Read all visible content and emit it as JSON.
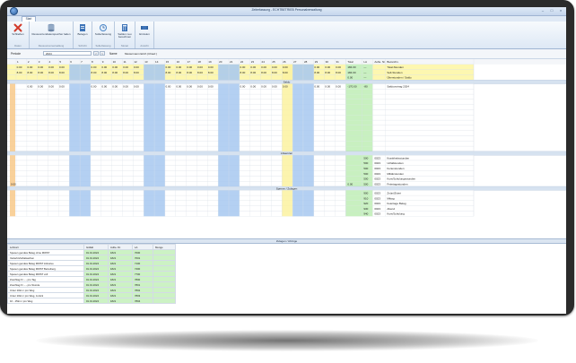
{
  "window": {
    "title": "Zeiterfassung - ECHTBETRIEB Personalverwaltung"
  },
  "ribbon": {
    "tab": "Start",
    "groups": [
      {
        "label": "Daten",
        "buttons": [
          {
            "label": "Schließen",
            "icon": "close-icon"
          }
        ]
      },
      {
        "label": "Ressourcenverwaltung",
        "buttons": [
          {
            "label": "Ressourcendatenspeicher laden",
            "icon": "database-icon"
          }
        ]
      },
      {
        "label": "Schicht",
        "buttons": [
          {
            "label": "Belegen",
            "icon": "document-icon"
          }
        ]
      },
      {
        "label": "Sollerfassung",
        "buttons": [
          {
            "label": "Sollerfassung",
            "icon": "clock-icon"
          }
        ]
      },
      {
        "label": "Monat",
        "buttons": [
          {
            "label": "Salden neu berechnen",
            "icon": "calculator-icon"
          }
        ]
      },
      {
        "label": "Ansicht",
        "buttons": [
          {
            "label": "Einzelen",
            "icon": "view-icon"
          }
        ]
      }
    ]
  },
  "filter": {
    "period_label": "Periode",
    "period_value": "2024",
    "prev": "<",
    "next": ">",
    "name_label": "Name",
    "name_value": "Mustermann Erich (Chauf.)"
  },
  "grid": {
    "days": [
      "1",
      "2",
      "3",
      "4",
      "5",
      "6",
      "7",
      "8",
      "9",
      "10",
      "11",
      "12",
      "13",
      "14",
      "15",
      "16",
      "17",
      "18",
      "19",
      "20",
      "21",
      "22",
      "23",
      "24",
      "25",
      "26",
      "27",
      "28",
      "29",
      "30",
      "31"
    ],
    "weekend_days": [
      6,
      7,
      13,
      14,
      20,
      21,
      27,
      28
    ],
    "highlight_day": 26,
    "col_headers": {
      "total": "Total",
      "account": "LA",
      "unit": "Aufte. Nr.",
      "desc": "Bezeichn."
    },
    "summary_rows": [
      {
        "label": "",
        "values": [
          "0.00",
          "0.00",
          "0.00",
          "0.00",
          "0.00",
          "",
          "",
          "0.00",
          "0.00",
          "0.00",
          "0.00",
          "0.00",
          "",
          "",
          "0.00",
          "0.00",
          "0.00",
          "0.00",
          "0.00",
          "",
          "",
          "0.00",
          "0.00",
          "0.00",
          "0.00",
          "0.00",
          "",
          "",
          "0.00",
          "0.00",
          "0.00"
        ],
        "total": "184.00",
        "account": "—",
        "unit": "",
        "desc": "Total-Stunden"
      },
      {
        "label": "",
        "values": [
          "8.00",
          "8.00",
          "8.00",
          "8.00",
          "8.00",
          "",
          "",
          "8.00",
          "8.00",
          "8.00",
          "8.00",
          "8.00",
          "",
          "",
          "8.00",
          "8.00",
          "8.00",
          "8.00",
          "8.00",
          "",
          "",
          "8.00",
          "8.00",
          "8.00",
          "8.00",
          "8.00",
          "",
          "",
          "8.00",
          "8.00",
          "8.00"
        ],
        "total": "184.00",
        "account": "—",
        "unit": "",
        "desc": "Soll-Stunden"
      },
      {
        "label": "",
        "values": [],
        "total": "0.00",
        "account": "—",
        "unit": "",
        "desc": "Überstunden / Saldo"
      }
    ],
    "sections": [
      {
        "title": "Saldo",
        "rows": [
          {
            "values": [
              "",
              "0.00",
              "0.00",
              "0.00",
              "0.00",
              "",
              "",
              "0.00",
              "0.00",
              "0.00",
              "0.00",
              "0.00",
              "",
              "",
              "0.00",
              "0.00",
              "0.00",
              "0.00",
              "0.00",
              "",
              "",
              "0.00",
              "0.00",
              "0.00",
              "0.00",
              "0.00",
              "",
              "",
              "0.00",
              "0.00",
              "0.00"
            ],
            "total": "-170.00",
            "account": "-80",
            "unit": "",
            "desc": "Saldovortrag 2024"
          }
        ],
        "empty_rows": 12
      },
      {
        "title": "Absenzen",
        "rows": [
          {
            "values": [],
            "total": "",
            "account": "500",
            "unit": "0023",
            "desc": "Krankheitsstunden"
          },
          {
            "values": [],
            "total": "",
            "account": "500",
            "unit": "0023",
            "desc": "Unfallstunden"
          },
          {
            "values": [],
            "total": "",
            "account": "500",
            "unit": "0023",
            "desc": "Ferienstunden"
          },
          {
            "values": [],
            "total": "",
            "account": "500",
            "unit": "0023",
            "desc": "Militärstunden"
          },
          {
            "values": [],
            "total": "",
            "account": "500",
            "unit": "0023",
            "desc": "Kurs/Schulungsstunden"
          },
          {
            "label": "0.00",
            "values": [],
            "total": "0.00",
            "account": "500",
            "unit": "0023",
            "desc": "Feiertagsstunden"
          }
        ],
        "empty_rows": 0
      },
      {
        "title": "Spesen / Zulagen",
        "rows": [
          {
            "values": [],
            "total": "",
            "account": "900",
            "unit": "0023",
            "desc": "Znüni/Zvieri"
          },
          {
            "values": [],
            "total": "",
            "account": "910",
            "unit": "0023",
            "desc": "Mittag"
          },
          {
            "values": [],
            "total": "",
            "account": "920",
            "unit": "0023",
            "desc": "Feiertage Belag"
          },
          {
            "values": [],
            "total": "",
            "account": "930",
            "unit": "0023",
            "desc": "Abend"
          },
          {
            "values": [],
            "total": "",
            "account": "940",
            "unit": "0023",
            "desc": "Kurs/Schulung"
          }
        ],
        "empty_rows": 0
      }
    ]
  },
  "bottom": {
    "title": "Zulagen / Abzüge",
    "headers": [
      "Lohnart",
      "Gültab",
      "Aufte.-Nr.",
      "LA",
      "Menge"
    ],
    "rows": [
      [
        "Spesen gemäss Beleg ohne MWST",
        "01.01.2024",
        "1821",
        "7000",
        ""
      ],
      [
        "Verkehrsforfaitsachen",
        "01.01.2024",
        "1821",
        "7001",
        ""
      ],
      [
        "Spesen gemäss Beleg MWST inklusive",
        "01.01.2024",
        "1821",
        "7100",
        ""
      ],
      [
        "Spesen gemäss Beleg MWST Betreiberg.",
        "01.01.2024",
        "1821",
        "7400",
        ""
      ],
      [
        "Spesen gemäss Beleg MWST voll",
        "01.01.2024",
        "1821",
        "7700",
        ""
      ],
      [
        "Zuschlag Fr. -.- pro Tag",
        "01.01.2024",
        "1821",
        "7800",
        ""
      ],
      [
        "Zuschlag Fr. -.- pro Stunde",
        "01.01.2024",
        "1821",
        "7801",
        ""
      ],
      [
        "Unter 10km / pro Weg",
        "01.01.2024",
        "1821",
        "7802",
        ""
      ],
      [
        "Unter 10km / pro Weg, zurück",
        "01.01.2024",
        "1821",
        "7803",
        ""
      ],
      [
        "10 - 15km / pro Weg",
        "01.01.2024",
        "1821",
        "7804",
        ""
      ]
    ]
  },
  "colors": {
    "weekend": "#a7c8f0",
    "first_col": "#f8c98a",
    "highlight": "#fbf2a0",
    "summary": "#fdf7b0",
    "total_col": "#c8f0c0",
    "section": "#d6e2f0",
    "grid_line": "#d9dfe7"
  }
}
